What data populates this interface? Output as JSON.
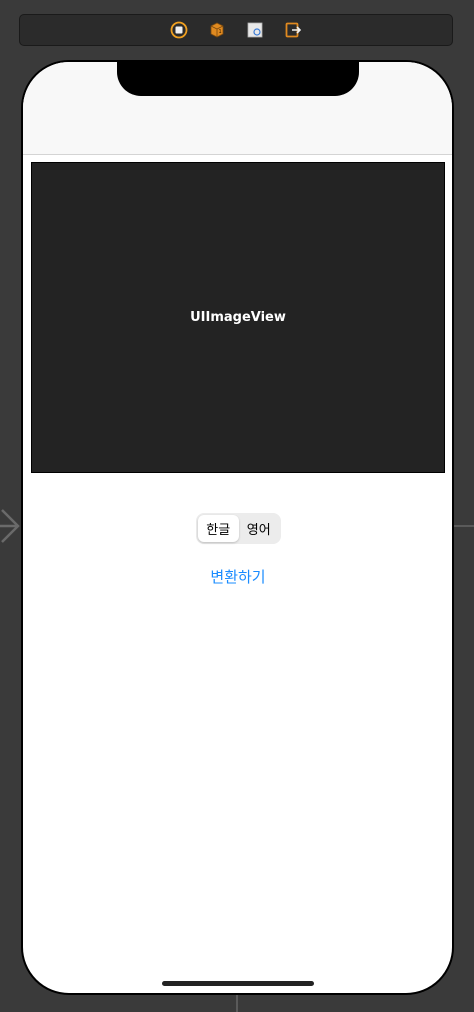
{
  "scene_dock": {
    "icons": [
      "view-controller-icon",
      "first-responder-icon",
      "storyboard-entry-icon",
      "exit-icon"
    ]
  },
  "image_view": {
    "label": "UIImageView"
  },
  "segmented_control": {
    "segments": [
      {
        "label": "한글",
        "selected": true
      },
      {
        "label": "영어",
        "selected": false
      }
    ]
  },
  "convert_button": {
    "label": "변환하기"
  },
  "colors": {
    "accent": "#1a8cff",
    "dock_icon": "#f0a020",
    "canvas_background": "#3a3a3a",
    "image_view_background": "#232323"
  }
}
